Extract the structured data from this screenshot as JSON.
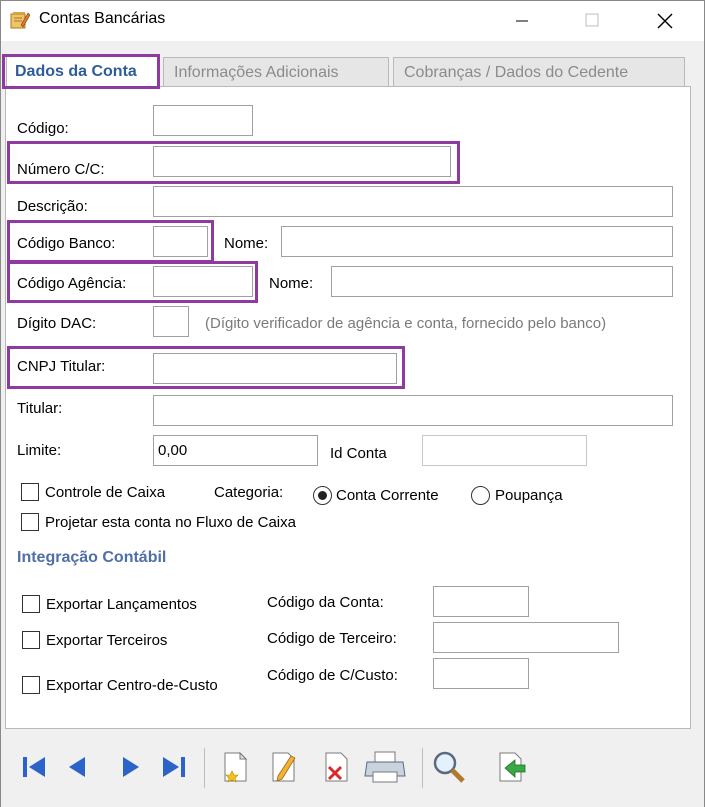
{
  "window": {
    "title": "Contas Bancárias"
  },
  "tabs": [
    {
      "label": "Dados da Conta"
    },
    {
      "label": "Informações Adicionais"
    },
    {
      "label": "Cobranças / Dados do Cedente"
    }
  ],
  "form": {
    "codigo": {
      "label": "Código:",
      "value": ""
    },
    "numero_cc": {
      "label": "Número C/C:",
      "value": ""
    },
    "descricao": {
      "label": "Descrição:",
      "value": ""
    },
    "codigo_banco": {
      "label": "Código Banco:",
      "value": "",
      "nome_label": "Nome:",
      "nome_value": ""
    },
    "codigo_agencia": {
      "label": "Código Agência:",
      "value": "",
      "nome_label": "Nome:",
      "nome_value": ""
    },
    "digito_dac": {
      "label": "Dígito DAC:",
      "value": "",
      "hint": "(Dígito verificador de agência e conta, fornecido pelo banco)"
    },
    "cnpj_titular": {
      "label": "CNPJ Titular:",
      "value": ""
    },
    "titular": {
      "label": "Titular:",
      "value": ""
    },
    "limite": {
      "label": "Limite:",
      "value": "0,00"
    },
    "id_conta": {
      "label": "Id Conta",
      "value": ""
    },
    "controle_caixa": {
      "label": "Controle de Caixa",
      "checked": false
    },
    "categoria": {
      "label": "Categoria:",
      "options": [
        "Conta Corrente",
        "Poupança"
      ],
      "selected": "Conta Corrente"
    },
    "projetar": {
      "label": "Projetar esta conta no Fluxo de Caixa",
      "checked": false
    }
  },
  "integracao": {
    "title": "Integração Contábil",
    "exportar_lancamentos": {
      "label": "Exportar Lançamentos",
      "checked": false
    },
    "exportar_terceiros": {
      "label": "Exportar Terceiros",
      "checked": false
    },
    "exportar_centro_custo": {
      "label": "Exportar Centro-de-Custo",
      "checked": false
    },
    "codigo_conta": {
      "label": "Código da Conta:",
      "value": ""
    },
    "codigo_terceiro": {
      "label": "Código de Terceiro:",
      "value": ""
    },
    "codigo_ccusto": {
      "label": "Código de C/Custo:",
      "value": ""
    }
  },
  "toolbar": {
    "icons": [
      "first-record-icon",
      "previous-record-icon",
      "next-record-icon",
      "last-record-icon",
      "new-record-icon",
      "edit-record-icon",
      "delete-record-icon",
      "print-icon",
      "search-icon",
      "exit-icon"
    ]
  },
  "colors": {
    "highlight": "#8e3aa0",
    "tab_active": "#2e5c9a",
    "section_title": "#4f6fa6",
    "nav_arrow": "#2b63c9"
  }
}
